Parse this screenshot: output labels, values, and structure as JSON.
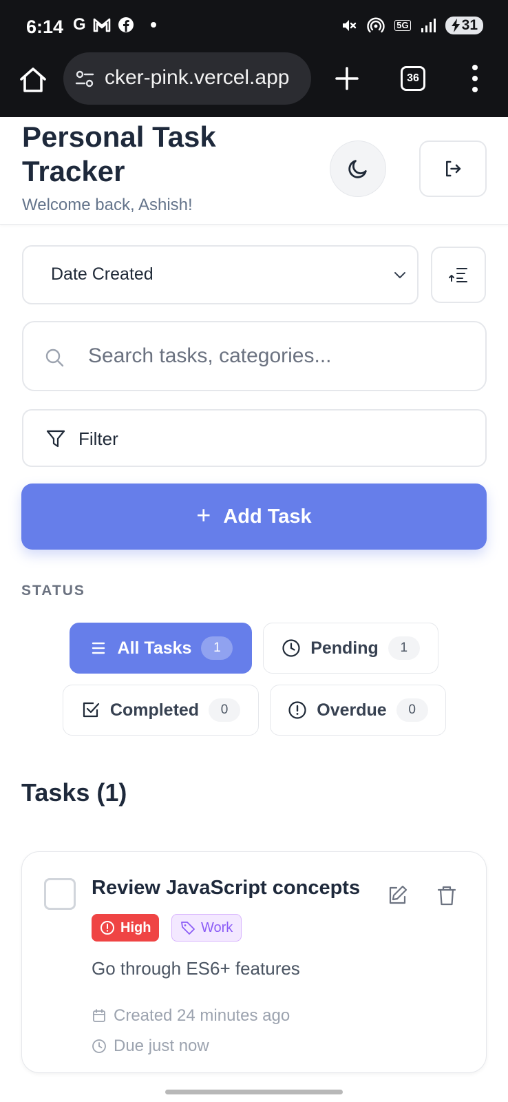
{
  "statusbar": {
    "time": "6:14",
    "left_icons": [
      "G",
      "M",
      "f"
    ],
    "network": "5G",
    "battery": "31"
  },
  "browser": {
    "url": "cker-pink.vercel.app",
    "tab_count": "36"
  },
  "header": {
    "title": "Personal Task Tracker",
    "welcome": "Welcome back, Ashish!"
  },
  "controls": {
    "sort_value": "Date Created",
    "search_placeholder": "Search tasks, categories...",
    "filter_label": "Filter",
    "add_task_label": "Add Task"
  },
  "status": {
    "heading": "STATUS",
    "chips": [
      {
        "label": "All Tasks",
        "count": "1",
        "icon": "list-icon",
        "active": true
      },
      {
        "label": "Pending",
        "count": "1",
        "icon": "clock-icon",
        "active": false
      },
      {
        "label": "Completed",
        "count": "0",
        "icon": "check-square-icon",
        "active": false
      },
      {
        "label": "Overdue",
        "count": "0",
        "icon": "alert-circle-icon",
        "active": false
      }
    ]
  },
  "tasks": {
    "heading": "Tasks (1)",
    "items": [
      {
        "title": "Review JavaScript concepts",
        "priority": "High",
        "category": "Work",
        "description": "Go through ES6+ features",
        "created": "Created 24 minutes ago",
        "due": "Due just now"
      }
    ]
  },
  "colors": {
    "accent": "#667eea",
    "priority_high": "#ef4444",
    "category_bg": "#f3e8ff",
    "category_text": "#8b5cf6"
  }
}
